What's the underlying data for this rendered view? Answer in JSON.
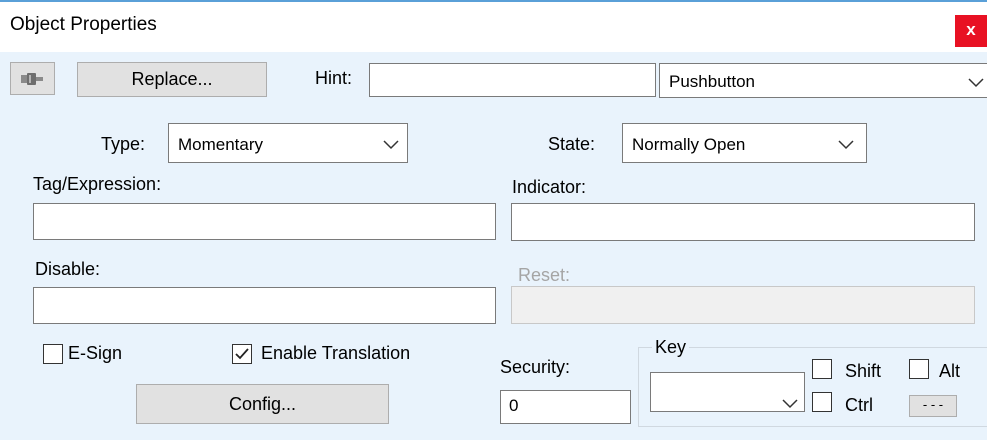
{
  "window": {
    "title": "Object Properties",
    "close_glyph": "x"
  },
  "toolbar": {
    "icon": "pushbutton-icon",
    "replace_label": "Replace...",
    "hint_label": "Hint:",
    "hint_value": "",
    "object_type": "Pushbutton"
  },
  "type": {
    "label": "Type:",
    "value": "Momentary"
  },
  "state": {
    "label": "State:",
    "value": "Normally Open"
  },
  "tag_expression": {
    "label": "Tag/Expression:",
    "value": ""
  },
  "indicator": {
    "label": "Indicator:",
    "value": ""
  },
  "disable": {
    "label": "Disable:",
    "value": ""
  },
  "reset": {
    "label": "Reset:",
    "value": "",
    "enabled": false
  },
  "esign": {
    "label": "E-Sign",
    "checked": false
  },
  "enable_translation": {
    "label": "Enable Translation",
    "checked": true
  },
  "config_label": "Config...",
  "security": {
    "label": "Security:",
    "value": "0"
  },
  "key": {
    "group_label": "Key",
    "value": "",
    "shift_label": "Shift",
    "shift_checked": false,
    "ctrl_label": "Ctrl",
    "ctrl_checked": false,
    "alt_label": "Alt",
    "alt_checked": false,
    "more_label": "- - -"
  },
  "colors": {
    "panel_bg": "#e9f3fc",
    "close_bg": "#e81123",
    "title_border": "#5aa0d8"
  }
}
